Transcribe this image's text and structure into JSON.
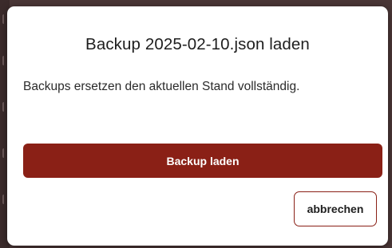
{
  "dialog": {
    "title": "Backup 2025-02-10.json laden",
    "message": "Backups ersetzen den aktuellen Stand vollständig.",
    "confirm_label": "Backup laden",
    "cancel_label": "abbrechen"
  },
  "colors": {
    "accent": "#8a2016",
    "backdrop": "#4a3636",
    "dialog_background": "#ffffff"
  }
}
